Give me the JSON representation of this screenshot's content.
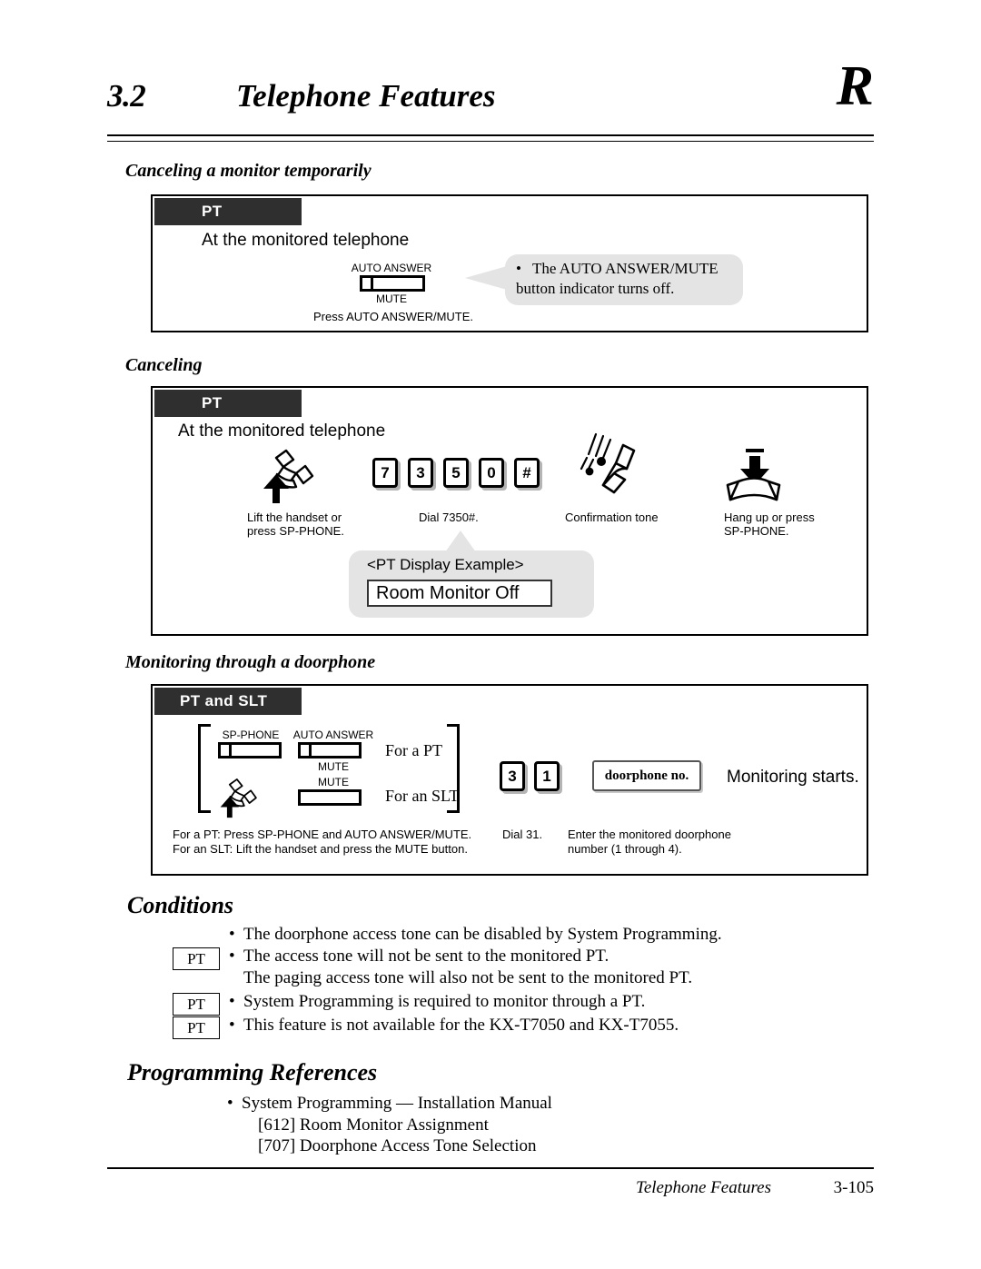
{
  "header": {
    "section_number": "3.2",
    "title": "Telephone Features",
    "corner_letter": "R"
  },
  "sections": [
    {
      "heading": "Canceling a monitor temporarily",
      "box_tab": "PT",
      "intro": "At the monitored telephone",
      "button": {
        "top_caption": "AUTO ANSWER",
        "bottom_caption": "MUTE",
        "icon": "feature-button-icon"
      },
      "step_label": "Press AUTO ANSWER/MUTE.",
      "callout": {
        "bullet": "•",
        "line1": "The AUTO ANSWER/MUTE",
        "line2": "button indicator turns off."
      }
    },
    {
      "heading": "Canceling",
      "box_tab": "PT",
      "intro": "At the monitored telephone",
      "steps": [
        {
          "icon": "lift-handset-icon",
          "label": "Lift the handset or\npress SP-PHONE."
        },
        {
          "icon": "dial-keys-icon",
          "label": "Dial 7350#."
        },
        {
          "icon": "confirmation-tone-icon",
          "label": "Confirmation tone"
        },
        {
          "icon": "hang-up-icon",
          "label": "Hang up or press\nSP-PHONE."
        }
      ],
      "dial_keys": [
        "7",
        "3",
        "5",
        "0",
        "#"
      ],
      "display_example": {
        "title": "<PT Display Example>",
        "lcd_text": "Room Monitor Off"
      }
    },
    {
      "heading": "Monitoring through a doorphone",
      "box_tab": "PT and SLT",
      "pt_row": {
        "sp_phone_caption": "SP-PHONE",
        "auto_answer_caption": "AUTO ANSWER",
        "mute_caption": "MUTE",
        "label": "For a PT"
      },
      "slt_row": {
        "mute_caption": "MUTE",
        "label": "For an SLT",
        "icon": "lift-handset-icon"
      },
      "dial_keys": [
        "3",
        "1"
      ],
      "doorphone_key": "doorphone no.",
      "result_text": "Monitoring starts.",
      "step_labels": {
        "left_line1": "For a PT: Press SP-PHONE and AUTO ANSWER/MUTE.",
        "left_line2": "For an SLT: Lift the handset and press the MUTE button.",
        "dial": "Dial 31.",
        "right_line1": "Enter the monitored doorphone",
        "right_line2": "number (1 through 4)."
      }
    }
  ],
  "conditions": {
    "heading": "Conditions",
    "items": [
      {
        "chip": "",
        "bullet": "•",
        "text": "The doorphone access tone can be disabled by System Programming."
      },
      {
        "chip": "PT",
        "bullet": "•",
        "text": "The access tone will not be sent to the monitored PT."
      },
      {
        "chip": "",
        "bullet": "",
        "text": "The paging access tone will also not be sent to the monitored PT."
      },
      {
        "chip": "PT",
        "bullet": "•",
        "text": "System Programming is required to monitor through a PT."
      },
      {
        "chip": "PT",
        "bullet": "•",
        "text": "This feature is not available for the KX-T7050 and KX-T7055."
      }
    ]
  },
  "programming_references": {
    "heading": "Programming References",
    "bullet": "•",
    "main": "System Programming — Installation Manual",
    "items": [
      "[612]  Room Monitor Assignment",
      "[707]  Doorphone Access Tone Selection"
    ]
  },
  "footer": {
    "title": "Telephone Features",
    "page": "3-105"
  }
}
